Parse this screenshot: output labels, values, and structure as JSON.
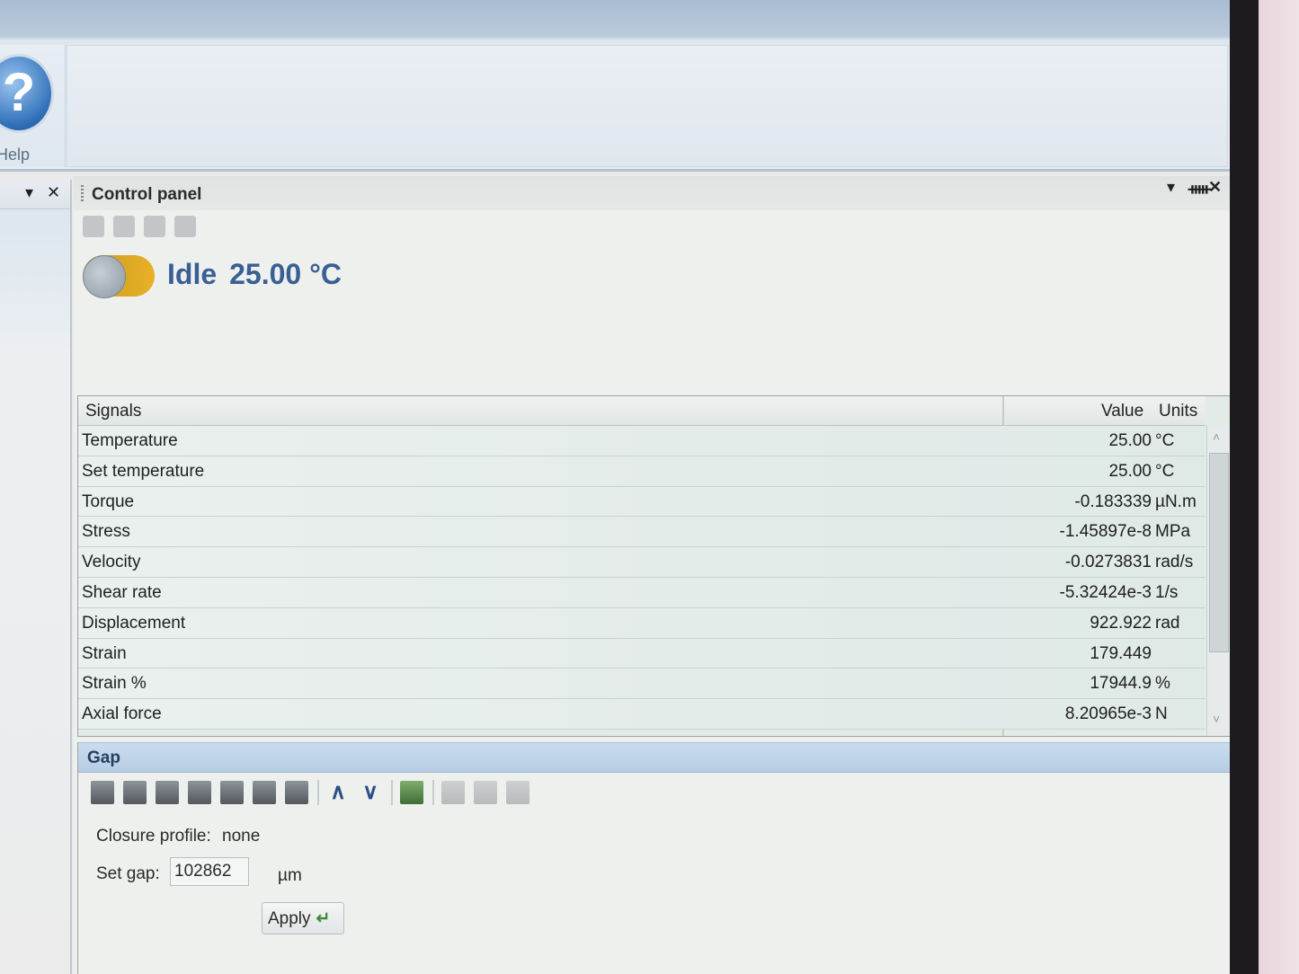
{
  "ribbon": {
    "help_label": "Help",
    "help_glyph": "?"
  },
  "left_dock": {
    "menu_glyph": "▾",
    "close_glyph": "✕"
  },
  "control_panel": {
    "title": "Control panel",
    "header_controls": {
      "menu": "▾",
      "pin": "ᚔ",
      "close": "✕"
    },
    "status": {
      "state": "Idle",
      "temperature": "25.00 °C"
    }
  },
  "signals": {
    "columns": {
      "signal": "Signals",
      "value": "Value",
      "units": "Units"
    },
    "rows": [
      {
        "name": "Temperature",
        "value": "25.00",
        "unit": "°C"
      },
      {
        "name": "Set temperature",
        "value": "25.00",
        "unit": "°C"
      },
      {
        "name": "Torque",
        "value": "-0.183339",
        "unit": "µN.m"
      },
      {
        "name": "Stress",
        "value": "-1.45897e-8",
        "unit": "MPa"
      },
      {
        "name": "Velocity",
        "value": "-0.0273831",
        "unit": "rad/s"
      },
      {
        "name": "Shear rate",
        "value": "-5.32424e-3",
        "unit": "1/s"
      },
      {
        "name": "Displacement",
        "value": "922.922",
        "unit": "rad"
      },
      {
        "name": "Strain",
        "value": "179.449",
        "unit": ""
      },
      {
        "name": "Strain %",
        "value": "17944.9",
        "unit": "%"
      },
      {
        "name": "Axial force",
        "value": "8.20965e-3",
        "unit": "N"
      }
    ],
    "scroll": {
      "up": "˄",
      "down": "˅"
    }
  },
  "gap": {
    "title": "Gap",
    "closure_profile_label": "Closure profile:",
    "closure_profile_value": "none",
    "set_gap_label": "Set gap:",
    "set_gap_value": "102862",
    "set_gap_unit": "µm",
    "apply_label": "Apply",
    "apply_glyph": "↵"
  }
}
